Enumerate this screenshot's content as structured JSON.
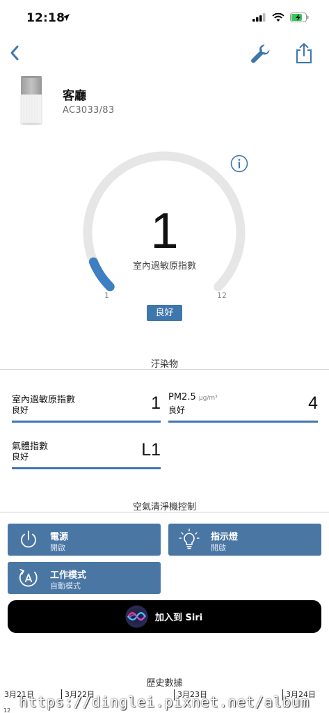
{
  "status_bar": {
    "time": "12:18"
  },
  "device": {
    "name": "客廳",
    "model": "AC3033/83"
  },
  "gauge": {
    "value": "1",
    "label": "室內過敏原指數",
    "min_label": "1",
    "max_label": "12",
    "status": "良好",
    "level_fraction": 0.0833,
    "track_color": "#e6e6e6",
    "fill_color": "#3e7fc1"
  },
  "pollutants": {
    "section_title": "汙染物",
    "items": [
      {
        "name": "室內過敏原指數",
        "unit": "",
        "status": "良好",
        "value": "1"
      },
      {
        "name": "PM2.5",
        "unit": "μg/m³",
        "status": "良好",
        "value": "4"
      },
      {
        "name": "氣體指數",
        "unit": "",
        "status": "良好",
        "value": "L1"
      }
    ]
  },
  "controls": {
    "section_title": "空氣清淨機控制",
    "power": {
      "label": "電源",
      "sub": "開啟",
      "icon": "power-icon"
    },
    "light": {
      "label": "指示燈",
      "sub": "開啟",
      "icon": "light-bulb-icon"
    },
    "mode": {
      "label": "工作模式",
      "sub": "自動模式",
      "icon": "auto-mode-icon"
    }
  },
  "siri": {
    "label": "加入到 Siri",
    "icon": "siri-orb-icon"
  },
  "history": {
    "section_title": "歷史數據",
    "dates": [
      "3月21日",
      "3月22日",
      "3月23日",
      "3月24日"
    ],
    "axis_tick": "12"
  },
  "watermark": {
    "text": "https://dinglei.pixnet.net/album"
  },
  "colors": {
    "accent": "#3e77ad",
    "button": "#4a76a4",
    "siri_bg": "#000000"
  }
}
